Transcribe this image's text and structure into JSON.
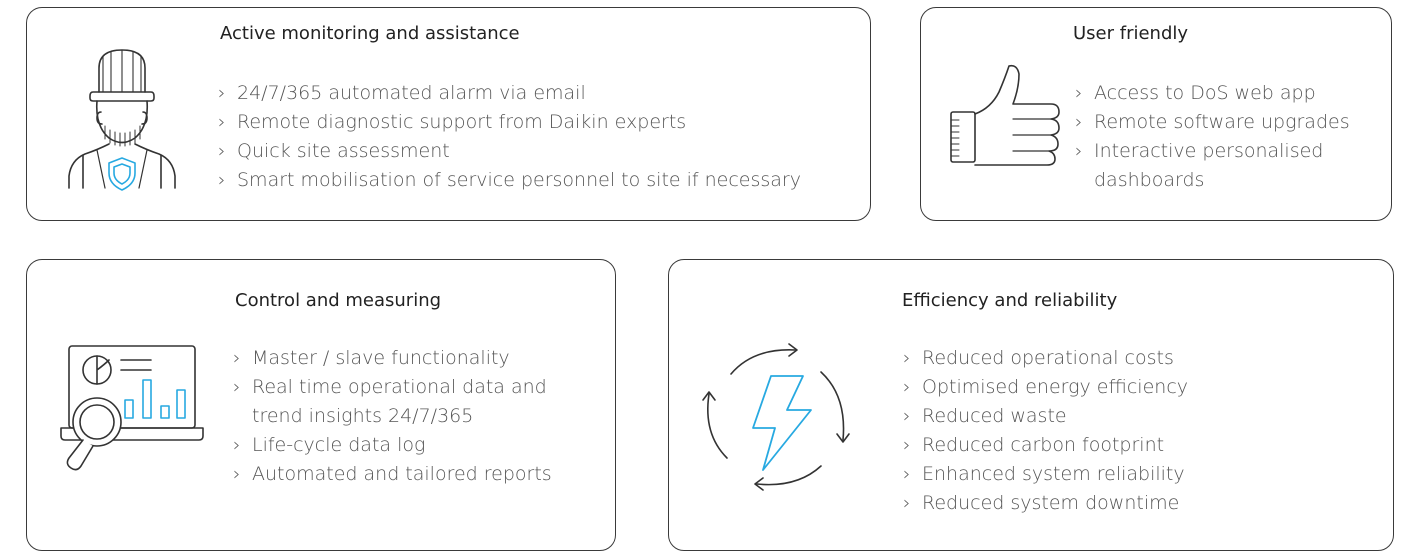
{
  "cards": [
    {
      "title": "Active monitoring and assistance",
      "icon": "technician-shield-icon",
      "bullet_marker": "›",
      "items": [
        "24/7/365 automated alarm via email",
        "Remote diagnostic support from Daikin experts",
        "Quick site assessment",
        "Smart mobilisation of service personnel to site if necessary"
      ]
    },
    {
      "title": "User friendly",
      "icon": "thumbs-up-icon",
      "bullet_marker": "›",
      "items": [
        "Access to DoS web app",
        "Remote software upgrades",
        "Interactive personalised dashboards"
      ]
    },
    {
      "title": "Control and measuring",
      "icon": "dashboard-magnifier-icon",
      "bullet_marker": "›",
      "items": [
        "Master / slave functionality",
        "Real time operational data and trend insights 24/7/365",
        "Life-cycle data log",
        "Automated and tailored reports"
      ]
    },
    {
      "title": "Efficiency and reliability",
      "icon": "lightning-cycle-icon",
      "bullet_marker": "›",
      "items": [
        "Reduced operational costs",
        "Optimised energy efficiency",
        "Reduced waste",
        "Reduced carbon footprint",
        "Enhanced system reliability",
        "Reduced system downtime"
      ]
    }
  ],
  "colors": {
    "outline": "#3a3a3a",
    "accent": "#27a9e1",
    "text": "#555555"
  }
}
